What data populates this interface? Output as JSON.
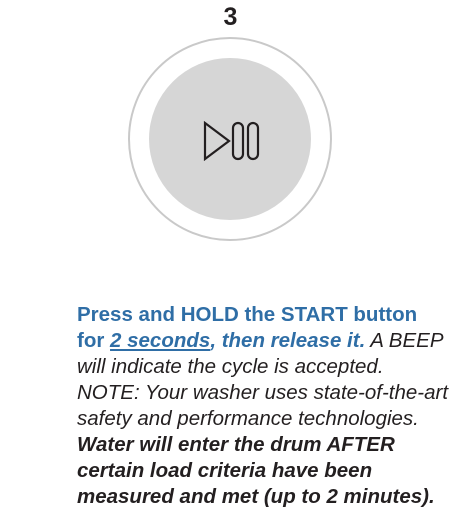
{
  "step": {
    "number": "3"
  },
  "start_button": {
    "icon": "play-pause-icon",
    "colors": {
      "outer_ring": "#c9c9c9",
      "inner_fill": "#d6d6d6",
      "icon_stroke": "#231f20"
    }
  },
  "instructions": {
    "line1": "Press and HOLD the START button",
    "line2_for": "for ",
    "line2_duration": "2 seconds",
    "line2_release": ", then release it.",
    "line2_beep": " A BEEP",
    "line3": "will indicate the cycle is accepted.",
    "line4": "NOTE: Your washer uses state-of-the-art",
    "line5": "safety and performance technologies.",
    "line6": "Water will enter the drum AFTER",
    "line7": "certain load criteria have been",
    "line8": "measured and met (up to 2 minutes).",
    "accent_color": "#2f6ea6",
    "text_color": "#231f20"
  }
}
